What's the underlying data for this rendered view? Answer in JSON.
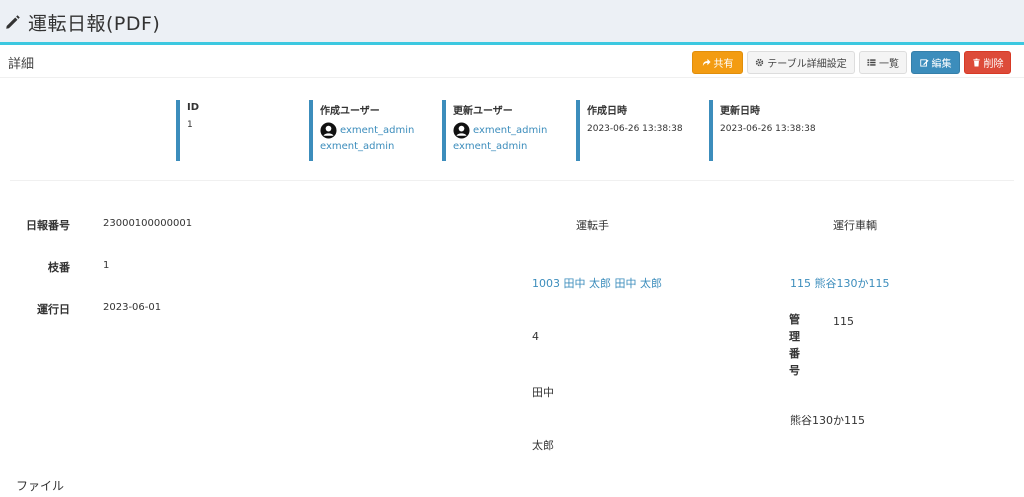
{
  "page": {
    "title": "運転日報(PDF)",
    "icon": "pencil-icon"
  },
  "box": {
    "title": "詳細"
  },
  "toolbar": {
    "share_label": "共有",
    "table_settings_label": "テーブル詳細設定",
    "list_label": "一覧",
    "edit_label": "編集",
    "delete_label": "削除"
  },
  "colors": {
    "accent": "#3c8dbc",
    "header_border": "#3cc8e0",
    "share": "#f39c12",
    "delete": "#dd4b39"
  },
  "meta": {
    "id_label": "ID",
    "id_value": "1",
    "created_by_label": "作成ユーザー",
    "created_by_user": "exment_admin",
    "created_by_user_sub": "exment_admin",
    "updated_by_label": "更新ユーザー",
    "updated_by_user": "exment_admin",
    "updated_by_user_sub": "exment_admin",
    "created_at_label": "作成日時",
    "created_at_value": "2023-06-26 13:38:38",
    "updated_at_label": "更新日時",
    "updated_at_value": "2023-06-26 13:38:38"
  },
  "fields": {
    "report_no_label": "日報番号",
    "report_no_value": "23000100000001",
    "branch_label": "枝番",
    "branch_value": "1",
    "run_date_label": "運行日",
    "run_date_value": "2023-06-01"
  },
  "driver": {
    "heading": "運転手",
    "link": "1003 田中 太郎 田中 太郎",
    "code": "4",
    "last_name": "田中",
    "first_name": "太郎"
  },
  "vehicle": {
    "heading": "運行車輌",
    "link": "115 熊谷130か115",
    "mgmt_label": "管理番号",
    "mgmt_value": "115",
    "plate": "熊谷130か115"
  },
  "file": {
    "label": "ファイル"
  }
}
